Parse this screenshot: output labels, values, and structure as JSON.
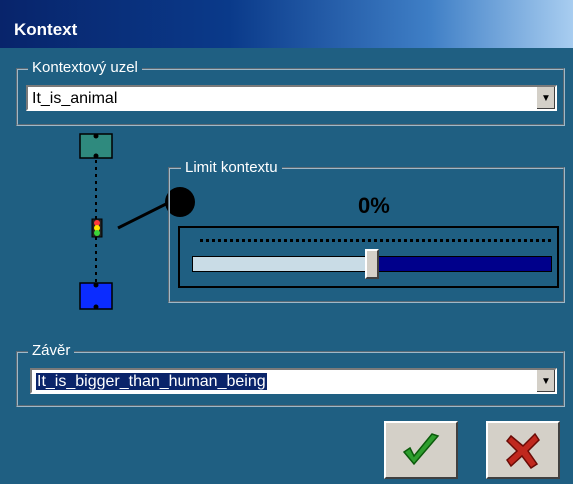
{
  "window": {
    "title": "Kontext"
  },
  "context_node": {
    "legend": "Kontextový uzel",
    "value": "It_is_animal"
  },
  "context_limit": {
    "legend": "Limit kontextu",
    "percent_label": "0%",
    "slider_level_percent": 50
  },
  "conclusion": {
    "legend": "Závěr",
    "value": "It_is_bigger_than_human_being"
  },
  "buttons": {
    "ok_icon": "check-icon",
    "cancel_icon": "x-icon",
    "ok_color": "#2e9e2e",
    "cancel_color": "#c0281e"
  },
  "colors": {
    "dialog_bg": "#1f5f82",
    "top_node": "#2f8a7e",
    "bottom_node": "#0b2cff",
    "slider_fill": "#00008b"
  }
}
